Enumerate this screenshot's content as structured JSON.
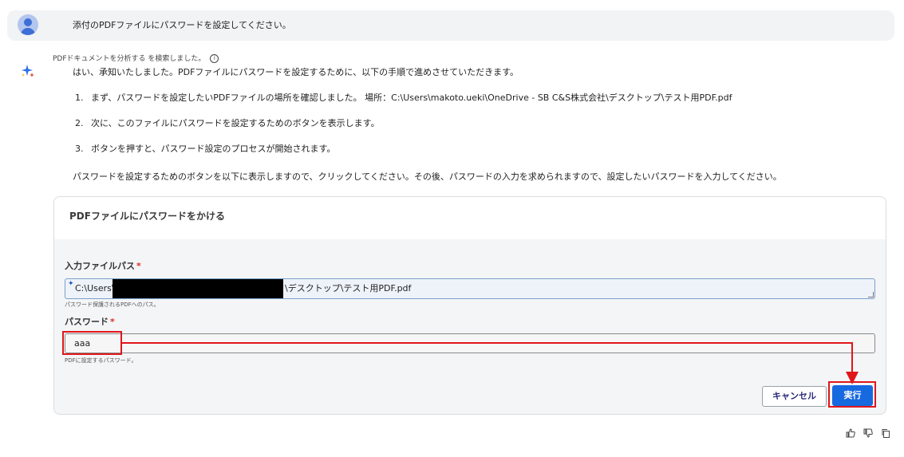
{
  "user": {
    "message": "添付のPDFファイルにパスワードを設定してください。"
  },
  "assistant": {
    "status": "PDFドキュメントを分析する を検索しました。",
    "intro": "はい、承知いたしました。PDFファイルにパスワードを設定するために、以下の手順で進めさせていただきます。",
    "steps": [
      {
        "num": "1.",
        "text": "まず、パスワードを設定したいPDFファイルの場所を確認しました。 場所：C:\\Users\\makoto.ueki\\OneDrive - SB C&S株式会社\\デスクトップ\\テスト用PDF.pdf"
      },
      {
        "num": "2.",
        "text": "次に、このファイルにパスワードを設定するためのボタンを表示します。"
      },
      {
        "num": "3.",
        "text": "ボタンを押すと、パスワード設定のプロセスが開始されます。"
      }
    ],
    "outro": "パスワードを設定するためのボタンを以下に表示しますので、クリックしてください。その後、パスワードの入力を求められますので、設定したいパスワードを入力してください。"
  },
  "card": {
    "title": "PDFファイルにパスワードをかける",
    "path_label": "入力ファイルパス",
    "path_prefix": "C:\\Users\\",
    "path_suffix": "\\デスクトップ\\テスト用PDF.pdf",
    "path_hint": "パスワード保護されるPDFへのパス。",
    "password_label": "パスワード",
    "password_value": "aaa",
    "password_hint": "PDFに設定するパスワード。",
    "required_mark": "*",
    "cancel_label": "キャンセル",
    "run_label": "実行"
  },
  "icons": {
    "ai": "sparkle-icon",
    "info": "info-icon",
    "thumbs_up": "thumbs-up-icon",
    "thumbs_down": "thumbs-down-icon",
    "copy": "copy-icon"
  },
  "colors": {
    "accent": "#1769e0",
    "highlight": "#e0161b",
    "required": "#d93025"
  }
}
